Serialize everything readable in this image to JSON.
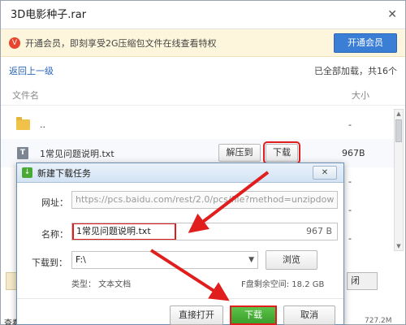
{
  "viewer": {
    "title": "3D电影种子.rar",
    "close_glyph": "✕",
    "promo": {
      "icon_text": "V",
      "text": "开通会员，即刻享受2G压缩包文件在线查看特权",
      "button": "开通会员"
    },
    "back_link": "返回上一级",
    "status": "已全部加载，共16个",
    "columns": {
      "name": "文件名",
      "size": "大小"
    },
    "rows": [
      {
        "name": "..",
        "size": "-",
        "icon": "folder-icon"
      },
      {
        "name": "1常见问题说明.txt",
        "size": "967B",
        "icon": "txt-icon",
        "icon_text": "T",
        "extract_label": "解压到",
        "download_label": "下载"
      },
      {
        "name": "",
        "size": "-"
      },
      {
        "name": "",
        "size": "-"
      },
      {
        "name": "",
        "size": "-"
      }
    ],
    "footer_left": "查看",
    "footer_right": "727.2M",
    "ghost_right": "闭"
  },
  "dialog": {
    "title": "新建下载任务",
    "close_glyph": "✕",
    "url_label": "网址：",
    "url_value": "https://pcs.baidu.com/rest/2.0/pcs/file?method=unzipdow",
    "name_label": "名称：",
    "name_value": "1常见问题说明.txt",
    "name_size": "967 B",
    "path_label": "下载到：",
    "path_value": "F:\\",
    "browse_label": "浏览",
    "type_text": "类型：  文本文档",
    "space_text": "F盘剩余空间: 18.2 GB",
    "open_label": "直接打开",
    "download_label": "下载",
    "cancel_label": "取消"
  },
  "colors": {
    "accent_blue": "#3b7ed6",
    "download_green": "#3a9f2b",
    "highlight_red": "#e01e1e",
    "promo_bg": "#fdf6dc"
  }
}
